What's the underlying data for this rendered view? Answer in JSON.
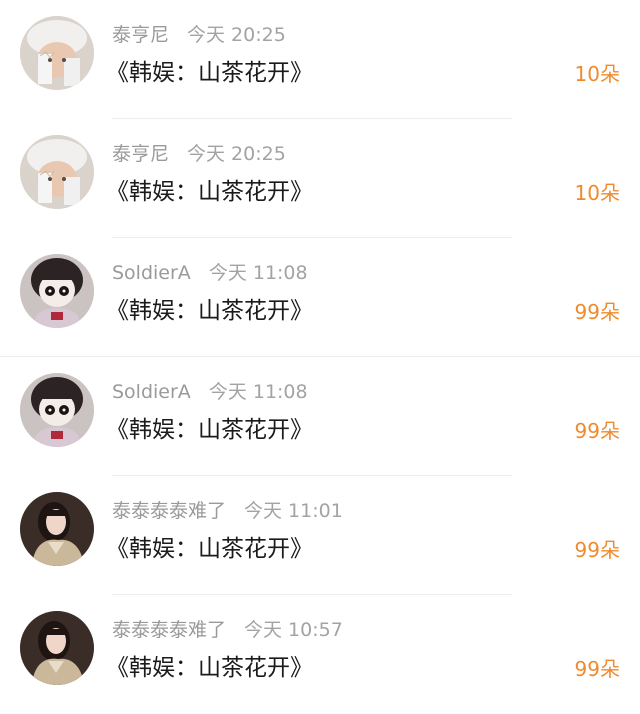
{
  "records": [
    {
      "name": "泰亨尼",
      "time": "今天 20:25",
      "title": "《韩娱：山茶花开》",
      "amount": "10朵",
      "avatar": "avatar-white-hat"
    },
    {
      "name": "泰亨尼",
      "time": "今天 20:25",
      "title": "《韩娱：山茶花开》",
      "amount": "10朵",
      "avatar": "avatar-white-hat"
    },
    {
      "name": "SoldierA",
      "time": "今天 11:08",
      "title": "《韩娱：山茶花开》",
      "amount": "99朵",
      "avatar": "avatar-doll"
    },
    {
      "name": "SoldierA",
      "time": "今天 11:08",
      "title": "《韩娱：山茶花开》",
      "amount": "99朵",
      "avatar": "avatar-doll"
    },
    {
      "name": "泰泰泰泰难了",
      "time": "今天 11:01",
      "title": "《韩娱：山茶花开》",
      "amount": "99朵",
      "avatar": "avatar-woman-portrait"
    },
    {
      "name": "泰泰泰泰难了",
      "time": "今天 10:57",
      "title": "《韩娱：山茶花开》",
      "amount": "99朵",
      "avatar": "avatar-woman-portrait"
    }
  ],
  "colors": {
    "accent": "#f08a2c",
    "meta": "#9a9a9a",
    "text": "#1b1b1b",
    "divider": "#ececec"
  }
}
